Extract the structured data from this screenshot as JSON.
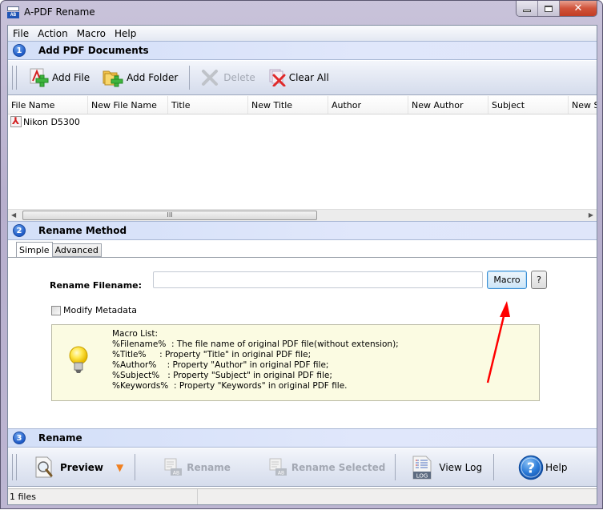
{
  "window": {
    "title": "A-PDF Rename",
    "app_icon_text": "AB",
    "controls": {
      "minimize": "minimize",
      "maximize": "maximize",
      "close": "✕"
    }
  },
  "menu": [
    "File",
    "Action",
    "Macro",
    "Help"
  ],
  "step1": {
    "number": "1",
    "title": "Add PDF Documents",
    "toolbar": [
      {
        "id": "add-file",
        "label": "Add File",
        "icon": "add-pdf-icon",
        "enabled": true
      },
      {
        "id": "add-folder",
        "label": "Add Folder",
        "icon": "add-folder-icon",
        "enabled": true
      },
      {
        "id": "delete",
        "label": "Delete",
        "icon": "delete-x-icon",
        "enabled": false
      },
      {
        "id": "clear-all",
        "label": "Clear All",
        "icon": "clear-all-icon",
        "enabled": true
      }
    ]
  },
  "file_table": {
    "columns": [
      "File Name",
      "New File Name",
      "Title",
      "New Title",
      "Author",
      "New Author",
      "Subject",
      "New Subject"
    ],
    "rows": [
      {
        "file_name": "Nikon D5300",
        "new_file_name": "",
        "title": "",
        "new_title": "",
        "author": "",
        "new_author": "",
        "subject": "",
        "new_subject": ""
      }
    ],
    "scrollbar_grip": "III"
  },
  "step2": {
    "number": "2",
    "title": "Rename Method",
    "tabs": [
      {
        "label": "Simple",
        "active": true
      },
      {
        "label": "Advanced",
        "active": false
      }
    ],
    "rename_filename_label": "Rename Filename:",
    "rename_filename_value": "",
    "macro_button": "Macro",
    "help_button": "?",
    "modify_metadata_label": "Modify Metadata",
    "modify_metadata_checked": false,
    "macro_list": [
      "Macro List:",
      "%Filename%  : The file name of original PDF file(without extension);",
      "%Title%     : Property \"Title\" in original PDF file;",
      "%Author%    : Property \"Author\" in original PDF file;",
      "%Subject%   : Property \"Subject\" in original PDF file;",
      "%Keywords%  : Property \"Keywords\" in original PDF file."
    ]
  },
  "step3": {
    "number": "3",
    "title": "Rename",
    "toolbar": [
      {
        "id": "preview",
        "label": "Preview",
        "enabled": true
      },
      {
        "id": "rename",
        "label": "Rename",
        "enabled": false
      },
      {
        "id": "rename-selected",
        "label": "Rename Selected",
        "enabled": false
      },
      {
        "id": "view-log",
        "label": "View Log",
        "enabled": true
      },
      {
        "id": "help",
        "label": "Help",
        "enabled": true
      }
    ],
    "log_icon_text": "LOG"
  },
  "status": {
    "file_count": "1 files"
  },
  "colors": {
    "annotation_arrow": "#ff0000",
    "accent": "#1e5ac6",
    "macro_box_bg": "#fbfbe2"
  }
}
